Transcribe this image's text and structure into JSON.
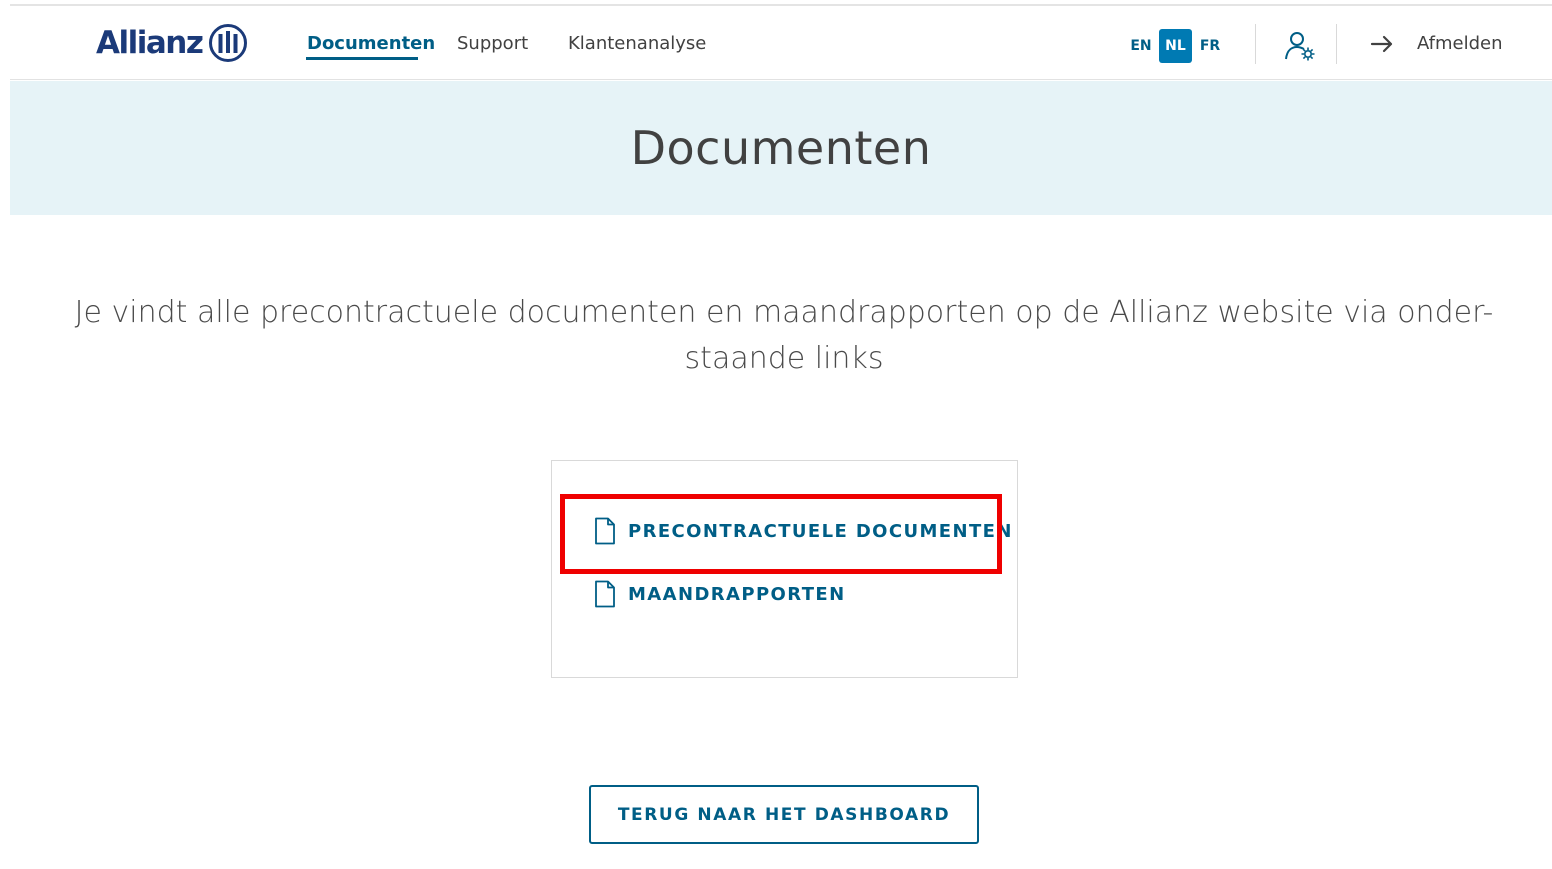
{
  "brand": {
    "name": "Allianz",
    "color": "#1b3a79",
    "logo_icon": "allianz-eagle-circle-icon"
  },
  "nav": {
    "items": [
      {
        "label": "Documenten",
        "active": true
      },
      {
        "label": "Support",
        "active": false
      },
      {
        "label": "Klantenanalyse",
        "active": false
      }
    ]
  },
  "languages": {
    "options": [
      "EN",
      "NL",
      "FR"
    ],
    "selected": "NL"
  },
  "header_actions": {
    "user_settings_icon": "user-settings-icon",
    "logout_icon": "arrow-right-icon",
    "logout_label": "Afmelden"
  },
  "hero": {
    "title": "Documenten",
    "background": "#e6f3f7"
  },
  "intro": {
    "line1": "Je vindt alle precontractuele documenten en maandrapporten op de Allianz website via onder-",
    "line2": "staande links"
  },
  "document_links": [
    {
      "label": "PRECONTRACTUELE DOCUMENTEN",
      "icon": "document-icon"
    },
    {
      "label": "MAANDRAPPORTEN",
      "icon": "document-icon"
    }
  ],
  "back_button": {
    "label": "TERUG NAAR HET DASHBOARD"
  },
  "colors": {
    "accent": "#005e86",
    "language_active": "#007ab3",
    "highlight": "#ef0000"
  }
}
